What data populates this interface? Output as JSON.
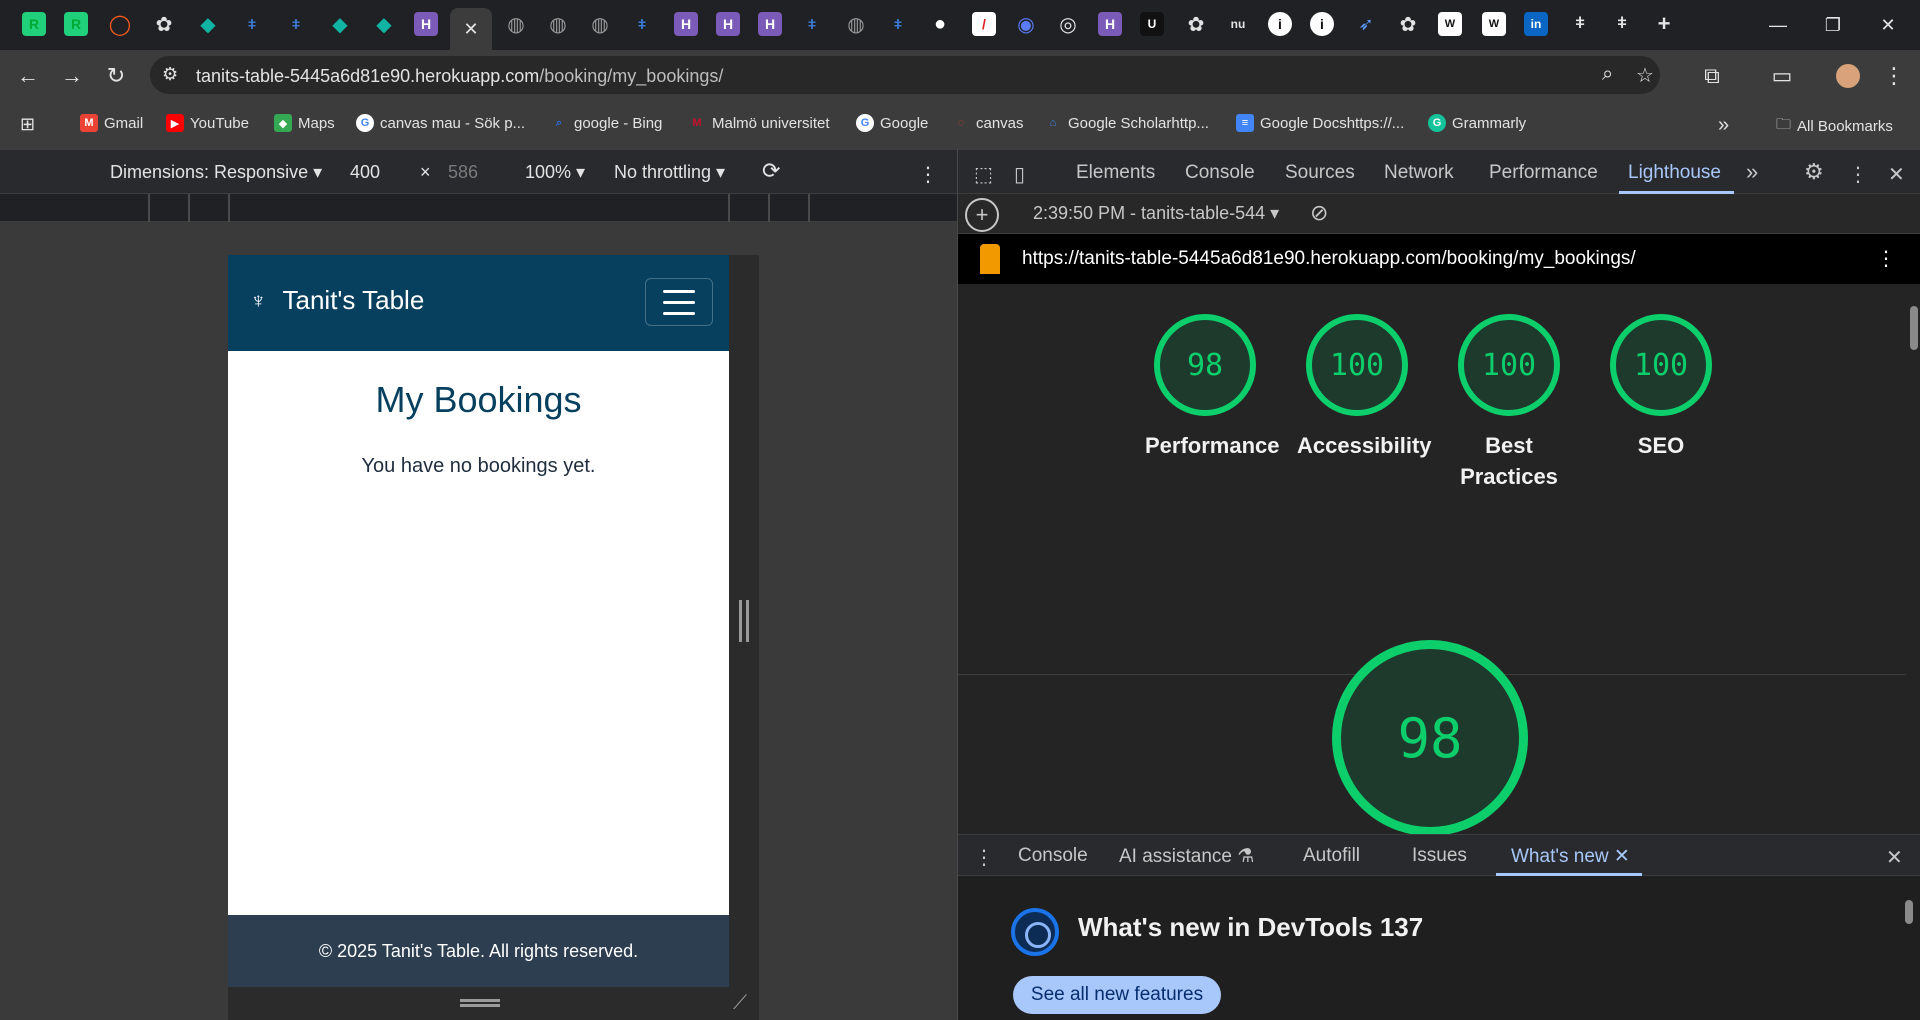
{
  "browser": {
    "active_tab_close": "✕",
    "new_tab": "+",
    "window_controls": {
      "minimize": "—",
      "restore": "❐",
      "close": "✕"
    },
    "address": {
      "host": "tanits-table-5445a6d81e90.herokuapp.com",
      "path": "/booking/my_bookings/"
    },
    "bookmarks": [
      {
        "label": "Gmail",
        "icon": "gmail-icon",
        "color": "#ea4335",
        "glyph": "M"
      },
      {
        "label": "YouTube",
        "icon": "youtube-icon",
        "color": "#ff0000",
        "glyph": "▶"
      },
      {
        "label": "Maps",
        "icon": "maps-icon",
        "color": "#34a853",
        "glyph": "◆"
      },
      {
        "label": "canvas mau - Sök p...",
        "icon": "google-icon",
        "color": "#4285f4",
        "glyph": "G"
      },
      {
        "label": "google - Bing",
        "icon": "bing-search-icon",
        "color": "#2b6ad8",
        "glyph": "⌕"
      },
      {
        "label": "Malmö universitet",
        "icon": "malmo-icon",
        "color": "#c8102e",
        "glyph": "M"
      },
      {
        "label": "Google",
        "icon": "google-icon",
        "color": "#4285f4",
        "glyph": "G"
      },
      {
        "label": "canvas",
        "icon": "canvas-icon",
        "color": "#e13f2b",
        "glyph": "◌"
      },
      {
        "label": "Google Scholarhttp...",
        "icon": "scholar-icon",
        "color": "#4285f4",
        "glyph": "⌂"
      },
      {
        "label": "Google Docshttps://...",
        "icon": "docs-icon",
        "color": "#4285f4",
        "glyph": "≡"
      },
      {
        "label": "Grammarly",
        "icon": "grammarly-icon",
        "color": "#15c39a",
        "glyph": "G"
      }
    ],
    "bookmarks_more": "»",
    "all_bookmarks": "All Bookmarks"
  },
  "device_toolbar": {
    "dimensions": "Dimensions: Responsive ▾",
    "width": "400",
    "times": "×",
    "height": "586",
    "zoom": "100% ▾",
    "throttling": "No throttling ▾"
  },
  "site": {
    "brand": "Tanit's Table",
    "brand_logo": "♆",
    "title": "My Bookings",
    "empty_message": "You have no bookings yet.",
    "footer": "© 2025 Tanit's Table. All rights reserved."
  },
  "devtools": {
    "tabs": [
      "Elements",
      "Console",
      "Sources",
      "Network",
      "Performance",
      "Lighthouse"
    ],
    "more_tabs": "»",
    "lighthouse_run": "2:39:50 PM - tanits-table-544 ▾",
    "report_url": "https://tanits-table-5445a6d81e90.herokuapp.com/booking/my_bookings/",
    "scores": [
      {
        "score": "98",
        "label": "Performance"
      },
      {
        "score": "100",
        "label": "Accessibility"
      },
      {
        "score": "100",
        "label": "Best Practices"
      },
      {
        "score": "100",
        "label": "SEO"
      }
    ],
    "big_score": "98",
    "score_color": "#0cce6b",
    "drawer_tabs": [
      "Console",
      "AI assistance ⚗",
      "Autofill",
      "Issues",
      "What's new ✕"
    ],
    "whats_new_title": "What's new in DevTools 137",
    "see_all": "See all new features"
  }
}
